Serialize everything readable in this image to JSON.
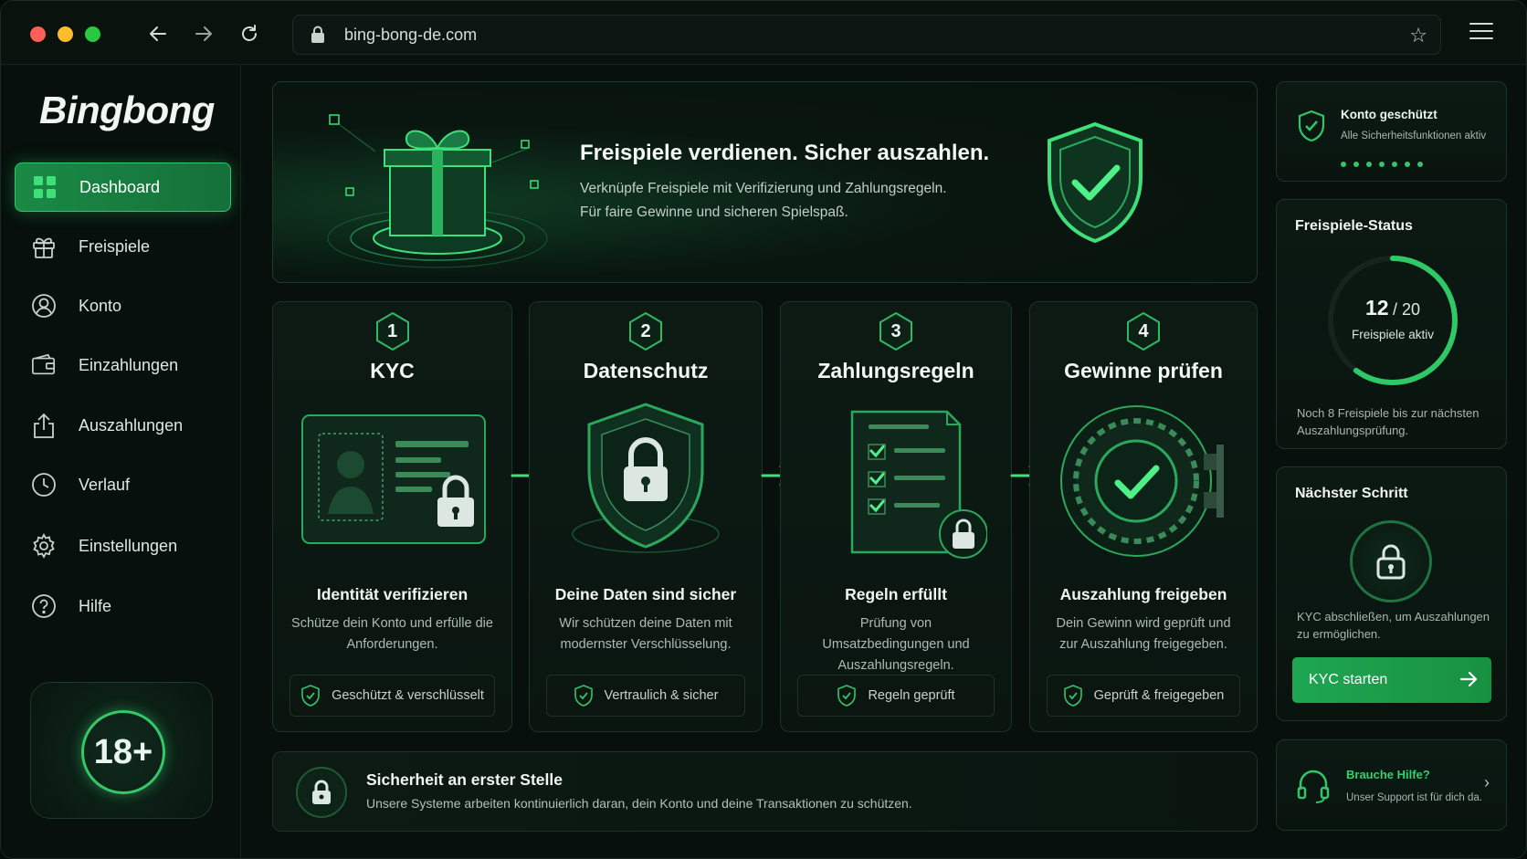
{
  "browser": {
    "url": "bing-bong-de.com"
  },
  "sidebar": {
    "logo": "Bingbong",
    "items": [
      {
        "label": "Dashboard",
        "icon": "grid-icon",
        "active": true
      },
      {
        "label": "Freispiele",
        "icon": "gift-icon"
      },
      {
        "label": "Konto",
        "icon": "user-icon"
      },
      {
        "label": "Einzahlungen",
        "icon": "wallet-icon"
      },
      {
        "label": "Auszahlungen",
        "icon": "upload-icon"
      },
      {
        "label": "Verlauf",
        "icon": "clock-icon"
      },
      {
        "label": "Einstellungen",
        "icon": "gear-icon"
      },
      {
        "label": "Hilfe",
        "icon": "help-icon"
      }
    ],
    "age_badge": "18+"
  },
  "hero": {
    "title": "Freispiele verdienen. Sicher auszahlen.",
    "line1": "Verknüpfe Freispiele mit Verifizierung und Zahlungsregeln.",
    "line2": "Für faire Gewinne und sicheren Spielspaß."
  },
  "steps": [
    {
      "num": "1",
      "title": "KYC",
      "subtitle": "Identität verifizieren",
      "desc": "Schütze dein Konto und erfülle die Anforderungen.",
      "badge": "Geschützt & verschlüsselt"
    },
    {
      "num": "2",
      "title": "Datenschutz",
      "subtitle": "Deine Daten sind sicher",
      "desc": "Wir schützen deine Daten mit modernster Verschlüsselung.",
      "badge": "Vertraulich & sicher"
    },
    {
      "num": "3",
      "title": "Zahlungsregeln",
      "subtitle": "Regeln erfüllt",
      "desc": "Prüfung von Umsatzbedingungen und Auszahlungsregeln.",
      "badge": "Regeln geprüft"
    },
    {
      "num": "4",
      "title": "Gewinne prüfen",
      "subtitle": "Auszahlung freigeben",
      "desc": "Dein Gewinn wird geprüft und zur Auszahlung freigegeben.",
      "badge": "Geprüft & freigegeben"
    }
  ],
  "banner": {
    "title": "Sicherheit an erster Stelle",
    "desc": "Unsere Systeme arbeiten kontinuierlich daran, dein Konto und deine Transaktionen zu schützen."
  },
  "right": {
    "protected": {
      "title": "Konto geschützt",
      "subtitle": "Alle Sicherheitsfunktionen aktiv"
    },
    "status": {
      "heading": "Freispiele-Status",
      "current": "12",
      "total": "/ 20",
      "caption": "Freispiele aktiv",
      "progress": 0.6,
      "foot": "Noch 8 Freispiele bis zur nächsten Auszahlungsprüfung."
    },
    "next": {
      "heading": "Nächster Schritt",
      "foot": "KYC abschließen, um Auszahlungen zu ermöglichen.",
      "button": "KYC starten"
    },
    "help": {
      "title": "Brauche Hilfe?",
      "subtitle": "Unser Support ist für dich da."
    }
  },
  "colors": {
    "accent": "#2ec866",
    "background": "#07100c",
    "card": "#0c1913"
  }
}
